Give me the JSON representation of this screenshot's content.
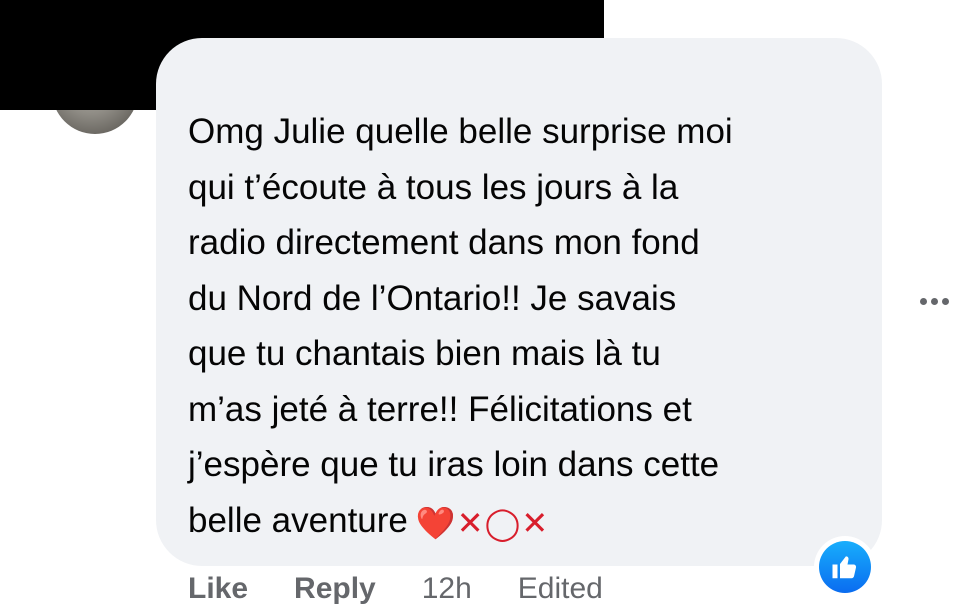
{
  "comment": {
    "text": "Omg Julie quelle belle surprise moi\nqui t’écoute à tous les jours à la\nradio directement dans mon fond\ndu Nord de l’Ontario!! Je savais\nque tu chantais bien mais là tu\nm’as jeté à terre!! Félicitations et\nj’espère que tu iras loin dans cette\nbelle aventure",
    "emoji": {
      "heart": "❤️",
      "x1": "✕",
      "o": "◯",
      "x2": "✕"
    }
  },
  "actions": {
    "like": "Like",
    "reply": "Reply",
    "time": "12h",
    "edited": "Edited"
  },
  "colors": {
    "bubble": "#f0f2f5",
    "text": "#050505",
    "secondary_text": "#65676b",
    "like_blue": "#0a6cf0",
    "heart_red": "#e0245e"
  },
  "icons": {
    "more": "more-horizontal-icon",
    "like_reaction": "thumbs-up-icon"
  }
}
